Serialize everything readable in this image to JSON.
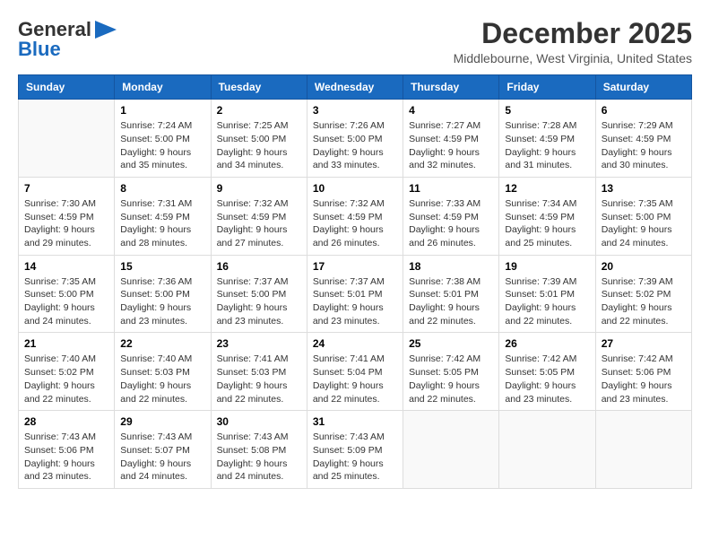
{
  "header": {
    "logo_line1": "General",
    "logo_line2": "Blue",
    "month": "December 2025",
    "location": "Middlebourne, West Virginia, United States"
  },
  "weekdays": [
    "Sunday",
    "Monday",
    "Tuesday",
    "Wednesday",
    "Thursday",
    "Friday",
    "Saturday"
  ],
  "weeks": [
    [
      {
        "day": "",
        "detail": ""
      },
      {
        "day": "1",
        "detail": "Sunrise: 7:24 AM\nSunset: 5:00 PM\nDaylight: 9 hours\nand 35 minutes."
      },
      {
        "day": "2",
        "detail": "Sunrise: 7:25 AM\nSunset: 5:00 PM\nDaylight: 9 hours\nand 34 minutes."
      },
      {
        "day": "3",
        "detail": "Sunrise: 7:26 AM\nSunset: 5:00 PM\nDaylight: 9 hours\nand 33 minutes."
      },
      {
        "day": "4",
        "detail": "Sunrise: 7:27 AM\nSunset: 4:59 PM\nDaylight: 9 hours\nand 32 minutes."
      },
      {
        "day": "5",
        "detail": "Sunrise: 7:28 AM\nSunset: 4:59 PM\nDaylight: 9 hours\nand 31 minutes."
      },
      {
        "day": "6",
        "detail": "Sunrise: 7:29 AM\nSunset: 4:59 PM\nDaylight: 9 hours\nand 30 minutes."
      }
    ],
    [
      {
        "day": "7",
        "detail": "Sunrise: 7:30 AM\nSunset: 4:59 PM\nDaylight: 9 hours\nand 29 minutes."
      },
      {
        "day": "8",
        "detail": "Sunrise: 7:31 AM\nSunset: 4:59 PM\nDaylight: 9 hours\nand 28 minutes."
      },
      {
        "day": "9",
        "detail": "Sunrise: 7:32 AM\nSunset: 4:59 PM\nDaylight: 9 hours\nand 27 minutes."
      },
      {
        "day": "10",
        "detail": "Sunrise: 7:32 AM\nSunset: 4:59 PM\nDaylight: 9 hours\nand 26 minutes."
      },
      {
        "day": "11",
        "detail": "Sunrise: 7:33 AM\nSunset: 4:59 PM\nDaylight: 9 hours\nand 26 minutes."
      },
      {
        "day": "12",
        "detail": "Sunrise: 7:34 AM\nSunset: 4:59 PM\nDaylight: 9 hours\nand 25 minutes."
      },
      {
        "day": "13",
        "detail": "Sunrise: 7:35 AM\nSunset: 5:00 PM\nDaylight: 9 hours\nand 24 minutes."
      }
    ],
    [
      {
        "day": "14",
        "detail": "Sunrise: 7:35 AM\nSunset: 5:00 PM\nDaylight: 9 hours\nand 24 minutes."
      },
      {
        "day": "15",
        "detail": "Sunrise: 7:36 AM\nSunset: 5:00 PM\nDaylight: 9 hours\nand 23 minutes."
      },
      {
        "day": "16",
        "detail": "Sunrise: 7:37 AM\nSunset: 5:00 PM\nDaylight: 9 hours\nand 23 minutes."
      },
      {
        "day": "17",
        "detail": "Sunrise: 7:37 AM\nSunset: 5:01 PM\nDaylight: 9 hours\nand 23 minutes."
      },
      {
        "day": "18",
        "detail": "Sunrise: 7:38 AM\nSunset: 5:01 PM\nDaylight: 9 hours\nand 22 minutes."
      },
      {
        "day": "19",
        "detail": "Sunrise: 7:39 AM\nSunset: 5:01 PM\nDaylight: 9 hours\nand 22 minutes."
      },
      {
        "day": "20",
        "detail": "Sunrise: 7:39 AM\nSunset: 5:02 PM\nDaylight: 9 hours\nand 22 minutes."
      }
    ],
    [
      {
        "day": "21",
        "detail": "Sunrise: 7:40 AM\nSunset: 5:02 PM\nDaylight: 9 hours\nand 22 minutes."
      },
      {
        "day": "22",
        "detail": "Sunrise: 7:40 AM\nSunset: 5:03 PM\nDaylight: 9 hours\nand 22 minutes."
      },
      {
        "day": "23",
        "detail": "Sunrise: 7:41 AM\nSunset: 5:03 PM\nDaylight: 9 hours\nand 22 minutes."
      },
      {
        "day": "24",
        "detail": "Sunrise: 7:41 AM\nSunset: 5:04 PM\nDaylight: 9 hours\nand 22 minutes."
      },
      {
        "day": "25",
        "detail": "Sunrise: 7:42 AM\nSunset: 5:05 PM\nDaylight: 9 hours\nand 22 minutes."
      },
      {
        "day": "26",
        "detail": "Sunrise: 7:42 AM\nSunset: 5:05 PM\nDaylight: 9 hours\nand 23 minutes."
      },
      {
        "day": "27",
        "detail": "Sunrise: 7:42 AM\nSunset: 5:06 PM\nDaylight: 9 hours\nand 23 minutes."
      }
    ],
    [
      {
        "day": "28",
        "detail": "Sunrise: 7:43 AM\nSunset: 5:06 PM\nDaylight: 9 hours\nand 23 minutes."
      },
      {
        "day": "29",
        "detail": "Sunrise: 7:43 AM\nSunset: 5:07 PM\nDaylight: 9 hours\nand 24 minutes."
      },
      {
        "day": "30",
        "detail": "Sunrise: 7:43 AM\nSunset: 5:08 PM\nDaylight: 9 hours\nand 24 minutes."
      },
      {
        "day": "31",
        "detail": "Sunrise: 7:43 AM\nSunset: 5:09 PM\nDaylight: 9 hours\nand 25 minutes."
      },
      {
        "day": "",
        "detail": ""
      },
      {
        "day": "",
        "detail": ""
      },
      {
        "day": "",
        "detail": ""
      }
    ]
  ]
}
